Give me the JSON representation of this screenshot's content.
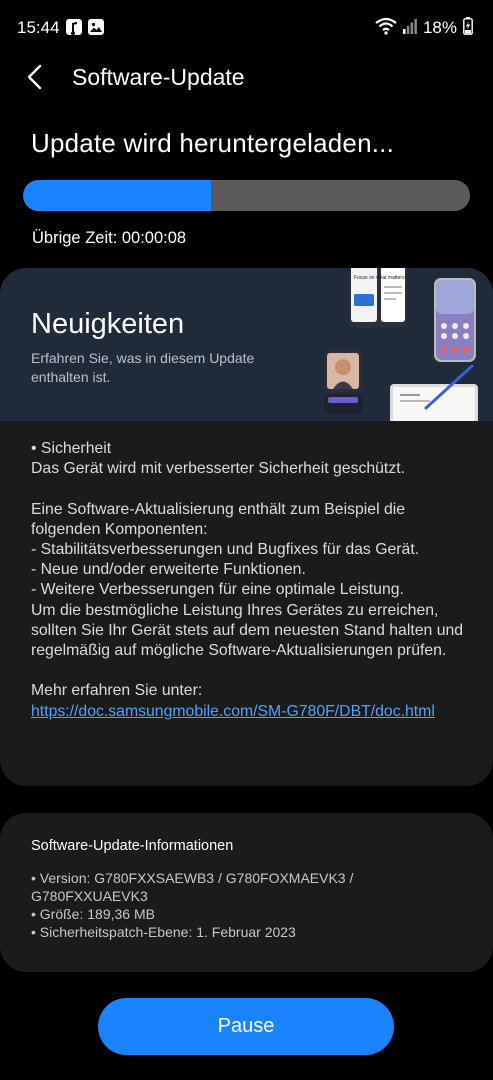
{
  "status_bar": {
    "time": "15:44",
    "battery": "18%",
    "icons": [
      "music-note-icon",
      "gallery-icon",
      "wifi-icon",
      "signal-icon",
      "battery-charging-icon"
    ]
  },
  "header": {
    "back_icon": "chevron-left-icon",
    "title": "Software-Update"
  },
  "download": {
    "status": "Update wird heruntergeladen...",
    "progress_fraction": 0.42,
    "remaining_label": "Übrige Zeit: 00:00:08"
  },
  "news": {
    "title": "Neuigkeiten",
    "subtitle": "Erfahren Sie, was in diesem Update enthalten ist.",
    "body": [
      "• Sicherheit",
      "Das Gerät wird mit verbesserter Sicherheit geschützt.",
      "",
      "Eine Software-Aktualisierung enthält zum Beispiel die folgenden Komponenten:",
      " - Stabilitätsverbesserungen und Bugfixes für das Gerät.",
      " - Neue und/oder erweiterte Funktionen.",
      " - Weitere Verbesserungen für eine optimale Leistung.",
      "Um die bestmögliche Leistung Ihres Gerätes zu erreichen, sollten Sie Ihr Gerät stets auf dem neuesten Stand halten und regelmäßig auf mögliche Software-Aktualisierungen prüfen.",
      "",
      "Mehr erfahren Sie unter:"
    ],
    "link": "https://doc.samsungmobile.com/SM-G780F/DBT/doc.html",
    "illustration_text": "Focus on what matters"
  },
  "info": {
    "title": "Software-Update-Informationen",
    "items": [
      "• Version: G780FXXSAEWB3 / G780FOXMAEVK3 / G780FXXUAEVK3",
      "• Größe: 189,36 MB",
      "• Sicherheitspatch-Ebene: 1. Februar 2023"
    ]
  },
  "actions": {
    "pause_label": "Pause"
  },
  "colors": {
    "accent": "#1a84ff",
    "background": "#000000",
    "card": "#1b1b1b",
    "banner": "#1f2b3a",
    "link": "#4da3ff"
  }
}
